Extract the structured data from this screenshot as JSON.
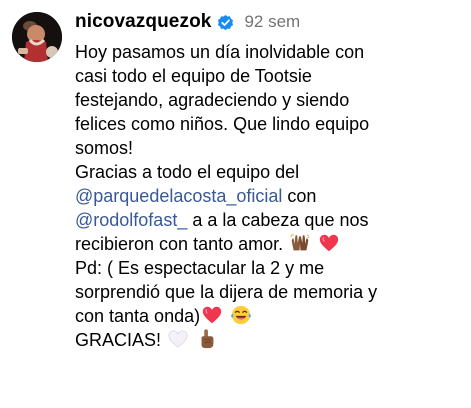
{
  "comment": {
    "username": "nicovazquezok",
    "timestamp": "92 sem",
    "avatar_icon": "profile-photo",
    "verified_icon": "verified-badge-icon",
    "colors": {
      "verified": "#1a8cf0",
      "mention": "#385898",
      "timestamp": "#737373"
    },
    "lines": [
      "Hoy pasamos un día inolvidable con",
      "casi todo el equipo de Tootsie",
      "festejando, agradeciendo y siendo",
      "felices como niños.  Que lindo equipo",
      "somos!",
      "Gracias a todo el equipo del"
    ],
    "mention1": "@parquedelacosta_oficial",
    "line7_suffix": "  con",
    "mention2": "@rodolfofast_",
    "line8_suffix": " a a la cabeza que nos",
    "line9_text": "recibieron con tanto amor. ",
    "line10_text": "Pd: ( Es espectacular la 2 y me",
    "line11_text": "sorprendió que la dijera de memoria y",
    "line12_text": "con tanta onda)",
    "line13_text": "GRACIAS! ",
    "emojis": {
      "clap": "raising-hands-emoji",
      "heart_red": "red-heart-emoji",
      "laughing": "laughing-tears-emoji",
      "heart_white": "white-heart-emoji",
      "point": "pointing-finger-emoji"
    }
  }
}
